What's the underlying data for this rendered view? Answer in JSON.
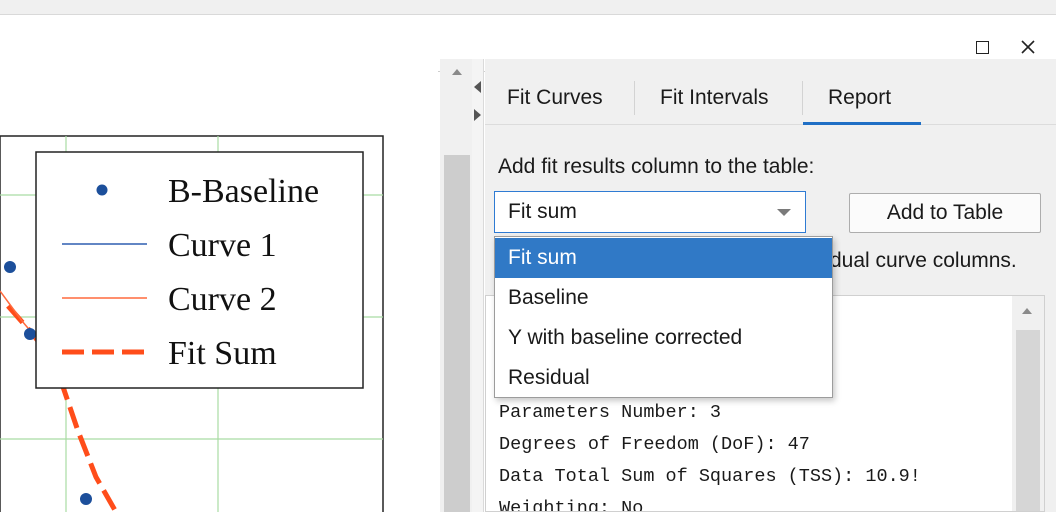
{
  "window": {
    "buttons": {
      "maximize": "maximize-icon",
      "close": "✕"
    }
  },
  "graph": {
    "colors": {
      "baseline_dots": "#1c4f9b",
      "curve1": "#2e5fb0",
      "curve2": "#ff6a3d",
      "fit_sum": "#ff4d1a",
      "grid": "#a9dca3"
    },
    "legend": {
      "items": [
        {
          "label": "B-Baseline",
          "style": "dot"
        },
        {
          "label": "Curve 1",
          "style": "line"
        },
        {
          "label": "Curve 2",
          "style": "line"
        },
        {
          "label": "Fit Sum",
          "style": "dashed"
        }
      ]
    }
  },
  "panel": {
    "tabs": [
      {
        "label": "Fit Curves",
        "active": false
      },
      {
        "label": "Fit Intervals",
        "active": false
      },
      {
        "label": "Report",
        "active": true
      }
    ],
    "add_column_label": "Add fit results column to the table:",
    "select": {
      "value": "Fit sum"
    },
    "add_to_table_label": "Add to Table",
    "partially_hidden_text": "dual curve columns.",
    "dropdown": {
      "options": [
        "Fit sum",
        "Baseline",
        "Y with baseline corrected",
        "Residual"
      ],
      "selected_index": 0
    },
    "report_lines": [
      "Parameters Number: 3",
      "Degrees of Freedom (DoF): 47",
      "Data Total Sum of Squares (TSS): 10.9!",
      "Weighting: No"
    ]
  }
}
